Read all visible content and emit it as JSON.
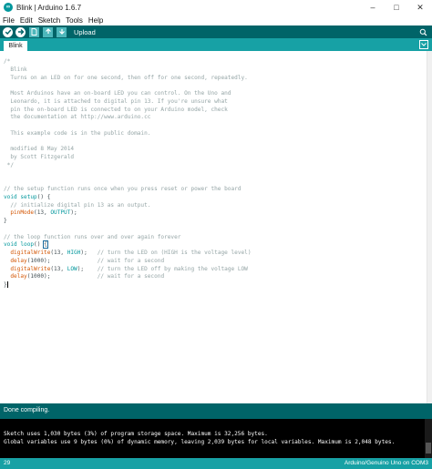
{
  "window": {
    "title": "Blink | Arduino 1.6.7",
    "controls": [
      "–",
      "□",
      "✕"
    ]
  },
  "menu": [
    "File",
    "Edit",
    "Sketch",
    "Tools",
    "Help"
  ],
  "toolbar": {
    "hover_label": "Upload",
    "buttons": [
      "verify-icon",
      "upload-icon",
      "new-icon",
      "open-icon",
      "save-icon",
      "serial-monitor-icon"
    ]
  },
  "tabs": [
    {
      "label": "Blink"
    }
  ],
  "code": [
    "/*",
    "  Blink",
    "  Turns on an LED on for one second, then off for one second, repeatedly.",
    "",
    "  Most Arduinos have an on-board LED you can control. On the Uno and",
    "  Leonardo, it is attached to digital pin 13. If you're unsure what",
    "  pin the on-board LED is connected to on your Arduino model, check",
    "  the documentation at http://www.arduino.cc",
    "",
    "  This example code is in the public domain.",
    "",
    "  modified 8 May 2014",
    "  by Scott Fitzgerald",
    " */",
    "",
    "",
    "// the setup function runs once when you press reset or power the board",
    "void setup() {",
    "  // initialize digital pin 13 as an output.",
    "  pinMode(13, OUTPUT);",
    "}",
    "",
    "// the loop function runs over and over again forever",
    "void loop() {",
    "  digitalWrite(13, HIGH);   // turn the LED on (HIGH is the voltage level)",
    "  delay(1000);              // wait for a second",
    "  digitalWrite(13, LOW);    // turn the LED off by making the voltage LOW",
    "  delay(1000);              // wait for a second",
    "}"
  ],
  "status": {
    "message": "Done compiling."
  },
  "console": [
    "Sketch uses 1,030 bytes (3%) of program storage space. Maximum is 32,256 bytes.",
    "Global variables use 9 bytes (0%) of dynamic memory, leaving 2,039 bytes for local variables. Maximum is 2,048 bytes."
  ],
  "footer": {
    "line_number": "29",
    "board": "Arduino/Genuino Uno on COM3"
  },
  "colors": {
    "toolbar": "#006468",
    "tabbar": "#17a1a5",
    "keyword": "#00979c",
    "function": "#d35400",
    "comment": "#95a5a6"
  }
}
